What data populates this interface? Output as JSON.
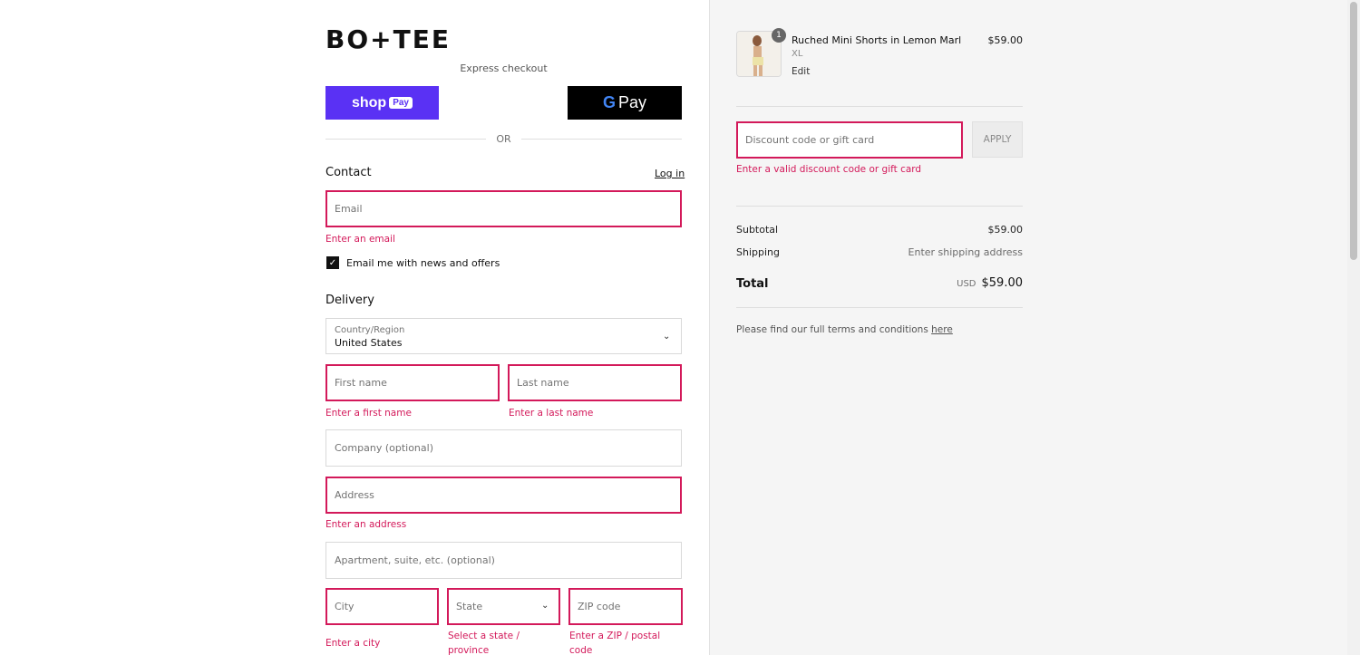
{
  "brand": {
    "logo": "BO+TEE"
  },
  "express": {
    "title": "Express checkout",
    "shoppay_label": "shop",
    "shoppay_chip": "Pay",
    "gpay_g": "G",
    "gpay_label": "Pay",
    "or": "OR"
  },
  "contact": {
    "title": "Contact",
    "login": "Log in",
    "email_placeholder": "Email",
    "email_error": "Enter an email",
    "newsletter_label": "Email me with news and offers",
    "newsletter_checked": true
  },
  "delivery": {
    "title": "Delivery",
    "country_label": "Country/Region",
    "country_value": "United States",
    "first_name_placeholder": "First name",
    "first_name_error": "Enter a first name",
    "last_name_placeholder": "Last name",
    "last_name_error": "Enter a last name",
    "company_placeholder": "Company (optional)",
    "address_placeholder": "Address",
    "address_error": "Enter an address",
    "apartment_placeholder": "Apartment, suite, etc. (optional)",
    "city_placeholder": "City",
    "city_error": "Enter a city",
    "state_placeholder": "State",
    "state_error": "Select a state / province",
    "zip_placeholder": "ZIP code",
    "zip_error": "Enter a ZIP / postal code"
  },
  "order": {
    "item": {
      "quantity": "1",
      "name": "Ruched Mini Shorts in Lemon Marl",
      "variant": "XL",
      "edit": "Edit",
      "price": "$59.00"
    },
    "discount": {
      "placeholder": "Discount code or gift card",
      "apply": "APPLY",
      "error": "Enter a valid discount code or gift card"
    },
    "subtotal_label": "Subtotal",
    "subtotal_value": "$59.00",
    "shipping_label": "Shipping",
    "shipping_value": "Enter shipping address",
    "total_label": "Total",
    "total_currency": "USD",
    "total_value": "$59.00",
    "terms_text": "Please find our full terms and conditions",
    "terms_link": "here"
  },
  "colors": {
    "error": "#d3195a",
    "shoppay": "#5a31f4",
    "gpay": "#000000",
    "summary_bg": "#f5f5f5"
  },
  "icons": [
    "chevron-down-icon",
    "checkmark-icon",
    "google-g-icon"
  ]
}
